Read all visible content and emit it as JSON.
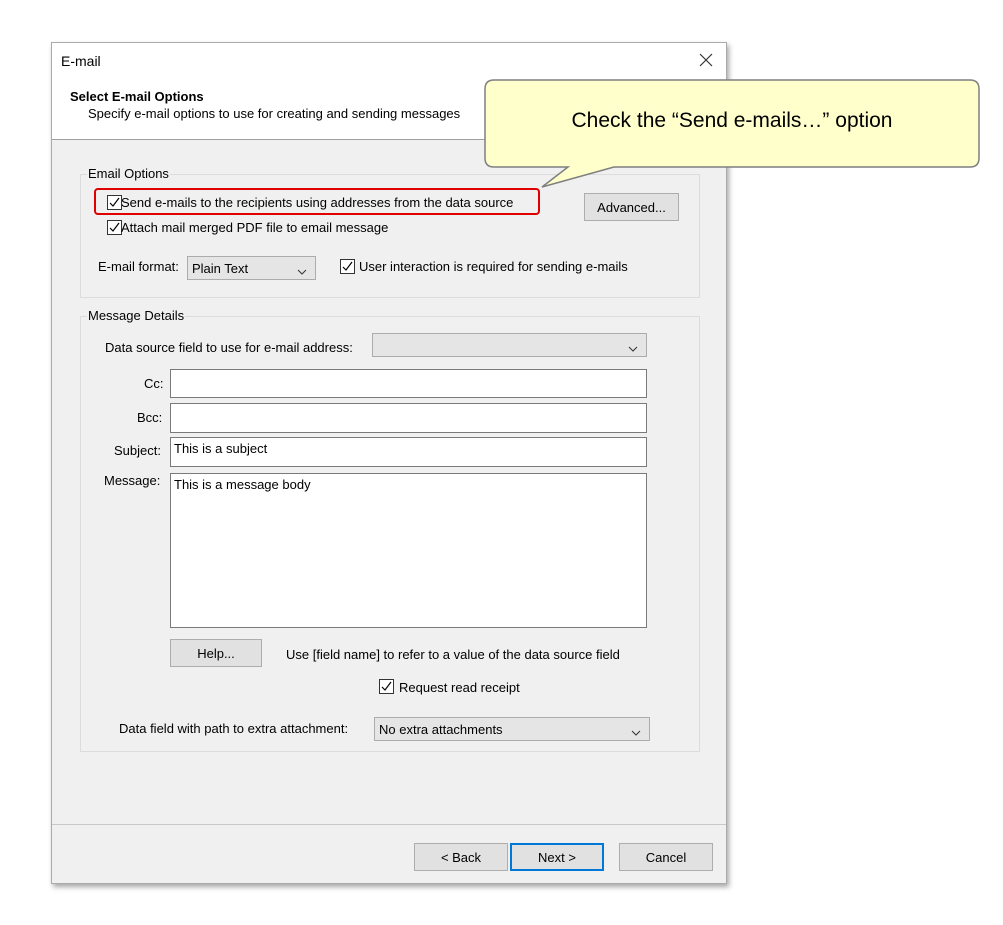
{
  "window": {
    "title": "E-mail"
  },
  "header": {
    "title": "Select E-mail Options",
    "subtitle": "Specify e-mail options to use for creating and sending messages"
  },
  "email_options": {
    "group_label": "Email Options",
    "send_emails_label": "Send e-mails to the recipients using addresses from the data source",
    "send_emails_checked": true,
    "attach_pdf_label": "Attach mail merged PDF file to email message",
    "attach_pdf_checked": true,
    "advanced_label": "Advanced...",
    "format_label": "E-mail format:",
    "format_value": "Plain Text",
    "user_interaction_label": "User interaction is required for sending e-mails",
    "user_interaction_checked": true
  },
  "message_details": {
    "group_label": "Message Details",
    "data_source_field_label": "Data source field to use for e-mail address:",
    "data_source_field_value": "",
    "cc_label": "Cc:",
    "cc_value": "",
    "bcc_label": "Bcc:",
    "bcc_value": "",
    "subject_label": "Subject:",
    "subject_value": "This is a subject",
    "message_label": "Message:",
    "message_value": "This is a message body",
    "help_label": "Help...",
    "help_hint": "Use [field name] to refer to a value of the data source field",
    "read_receipt_label": "Request read receipt",
    "read_receipt_checked": true,
    "attachment_label": "Data field with path to extra attachment:",
    "attachment_value": "No extra attachments"
  },
  "footer": {
    "back_label": "< Back",
    "next_label": "Next >",
    "cancel_label": "Cancel"
  },
  "callout": {
    "text": "Check the “Send e-mails…” option",
    "fill": "#ffffcc",
    "border": "#7f7f7f"
  },
  "highlight": {
    "color": "#e00000"
  },
  "colors": {
    "default_button_border": "#0078d7",
    "dialog_bg": "#f0f0f0"
  }
}
